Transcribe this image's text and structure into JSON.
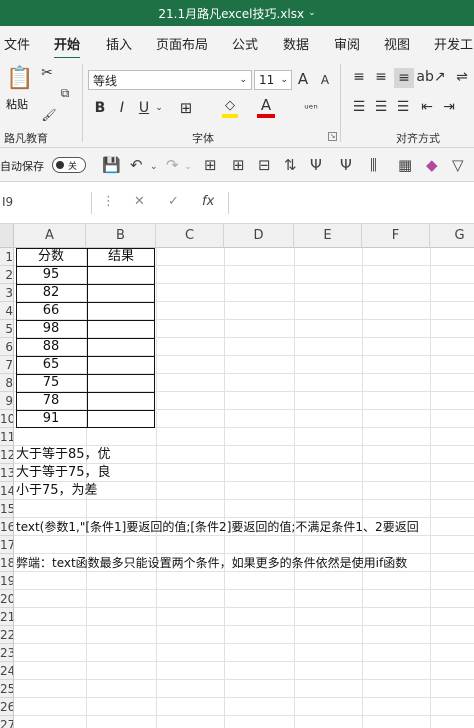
{
  "title_bar": {
    "title": "21.1月路凡excel技巧.xlsx",
    "arrow": "⌄"
  },
  "tabs": [
    "文件",
    "开始",
    "插入",
    "页面布局",
    "公式",
    "数据",
    "审阅",
    "视图",
    "开发工"
  ],
  "active_tab": "开始",
  "ribbon": {
    "paste_label": "粘贴",
    "clipboard_group": "路凡教育",
    "font_name": "等线",
    "font_size": "11",
    "font_group": "字体",
    "align_group": "对齐方式",
    "bold": "B",
    "italic": "I",
    "underline": "U",
    "font_color_letter": "A",
    "grow_font": "A",
    "shrink_font": "A",
    "highlight_color": "#ffe600",
    "font_color": "#e00000"
  },
  "qat": {
    "autosave_label": "自动保存",
    "autosave_state": "关"
  },
  "formula_bar": {
    "name_box": "I9",
    "fx": "fx",
    "value": ""
  },
  "grid": {
    "columns": [
      "A",
      "B",
      "C",
      "D",
      "E",
      "F",
      "G"
    ],
    "rows": [
      "1",
      "2",
      "3",
      "4",
      "5",
      "6",
      "7",
      "8",
      "9",
      "10",
      "11",
      "12",
      "13",
      "14",
      "15",
      "16",
      "17",
      "18",
      "19",
      "20",
      "21",
      "22",
      "23",
      "24",
      "25",
      "26",
      "27"
    ],
    "header_a": "分数",
    "header_b": "结果",
    "scores": [
      "95",
      "82",
      "66",
      "98",
      "88",
      "65",
      "75",
      "78",
      "91"
    ],
    "notes": {
      "r12": "大于等于85，优",
      "r13": "大于等于75，良",
      "r14": "小于75，为差",
      "r16": "text(参数1,\"[条件1]要返回的值;[条件2]要返回的值;不满足条件1、2要返回",
      "r18": "弊端：text函数最多只能设置两个条件，如果更多的条件依然是使用if函数"
    }
  }
}
